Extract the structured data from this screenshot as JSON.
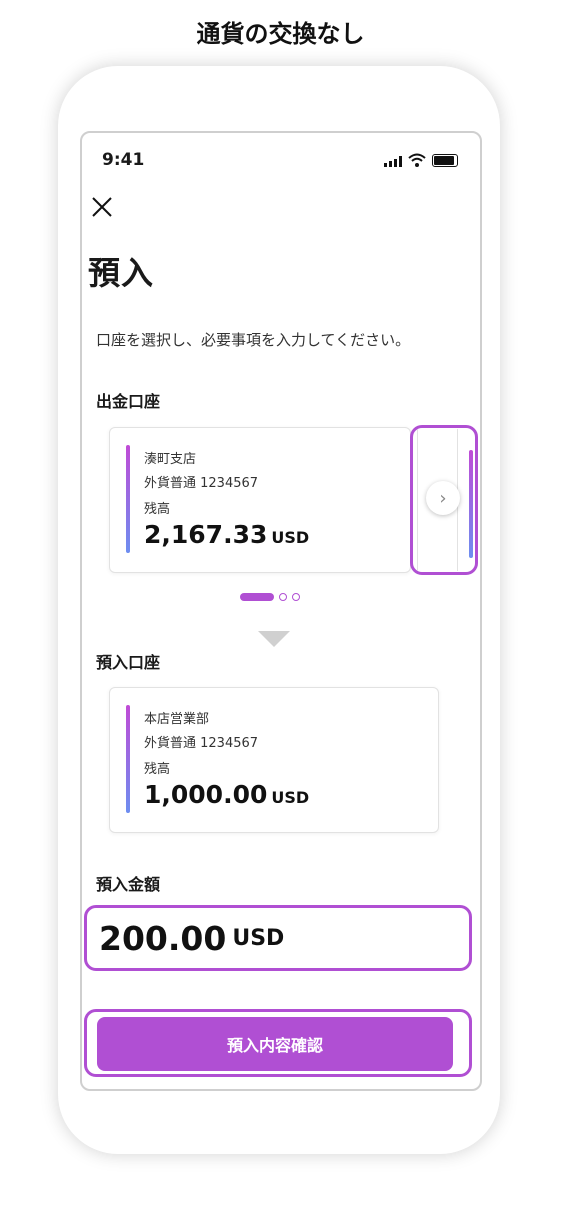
{
  "caption": "通貨の交換なし",
  "status_bar": {
    "time": "9:41",
    "icons": [
      "signal-icon",
      "wifi-icon",
      "battery-icon"
    ]
  },
  "header": {
    "close_icon": "close-icon",
    "title": "預入"
  },
  "instruction": "口座を選択し、必要事項を入力してください。",
  "source_account": {
    "section_label": "出金口座",
    "branch": "湊町支店",
    "account": "外貨普通 1234567",
    "balance_label": "残高",
    "balance": "2,167.33",
    "currency": "USD"
  },
  "carousel": {
    "pages": 3,
    "active_index": 0,
    "next_icon": "chevron-right-icon"
  },
  "destination_account": {
    "section_label": "預入口座",
    "branch": "本店営業部",
    "account": "外貨普通 1234567",
    "balance_label": "残高",
    "balance": "1,000.00",
    "currency": "USD"
  },
  "deposit_amount": {
    "section_label": "預入金額",
    "value": "200.00",
    "currency": "USD"
  },
  "confirm_button_label": "預入内容確認",
  "colors": {
    "accent": "#b04fd3",
    "gradient_top": "#c04bd6",
    "gradient_bottom": "#6d8ef0"
  }
}
